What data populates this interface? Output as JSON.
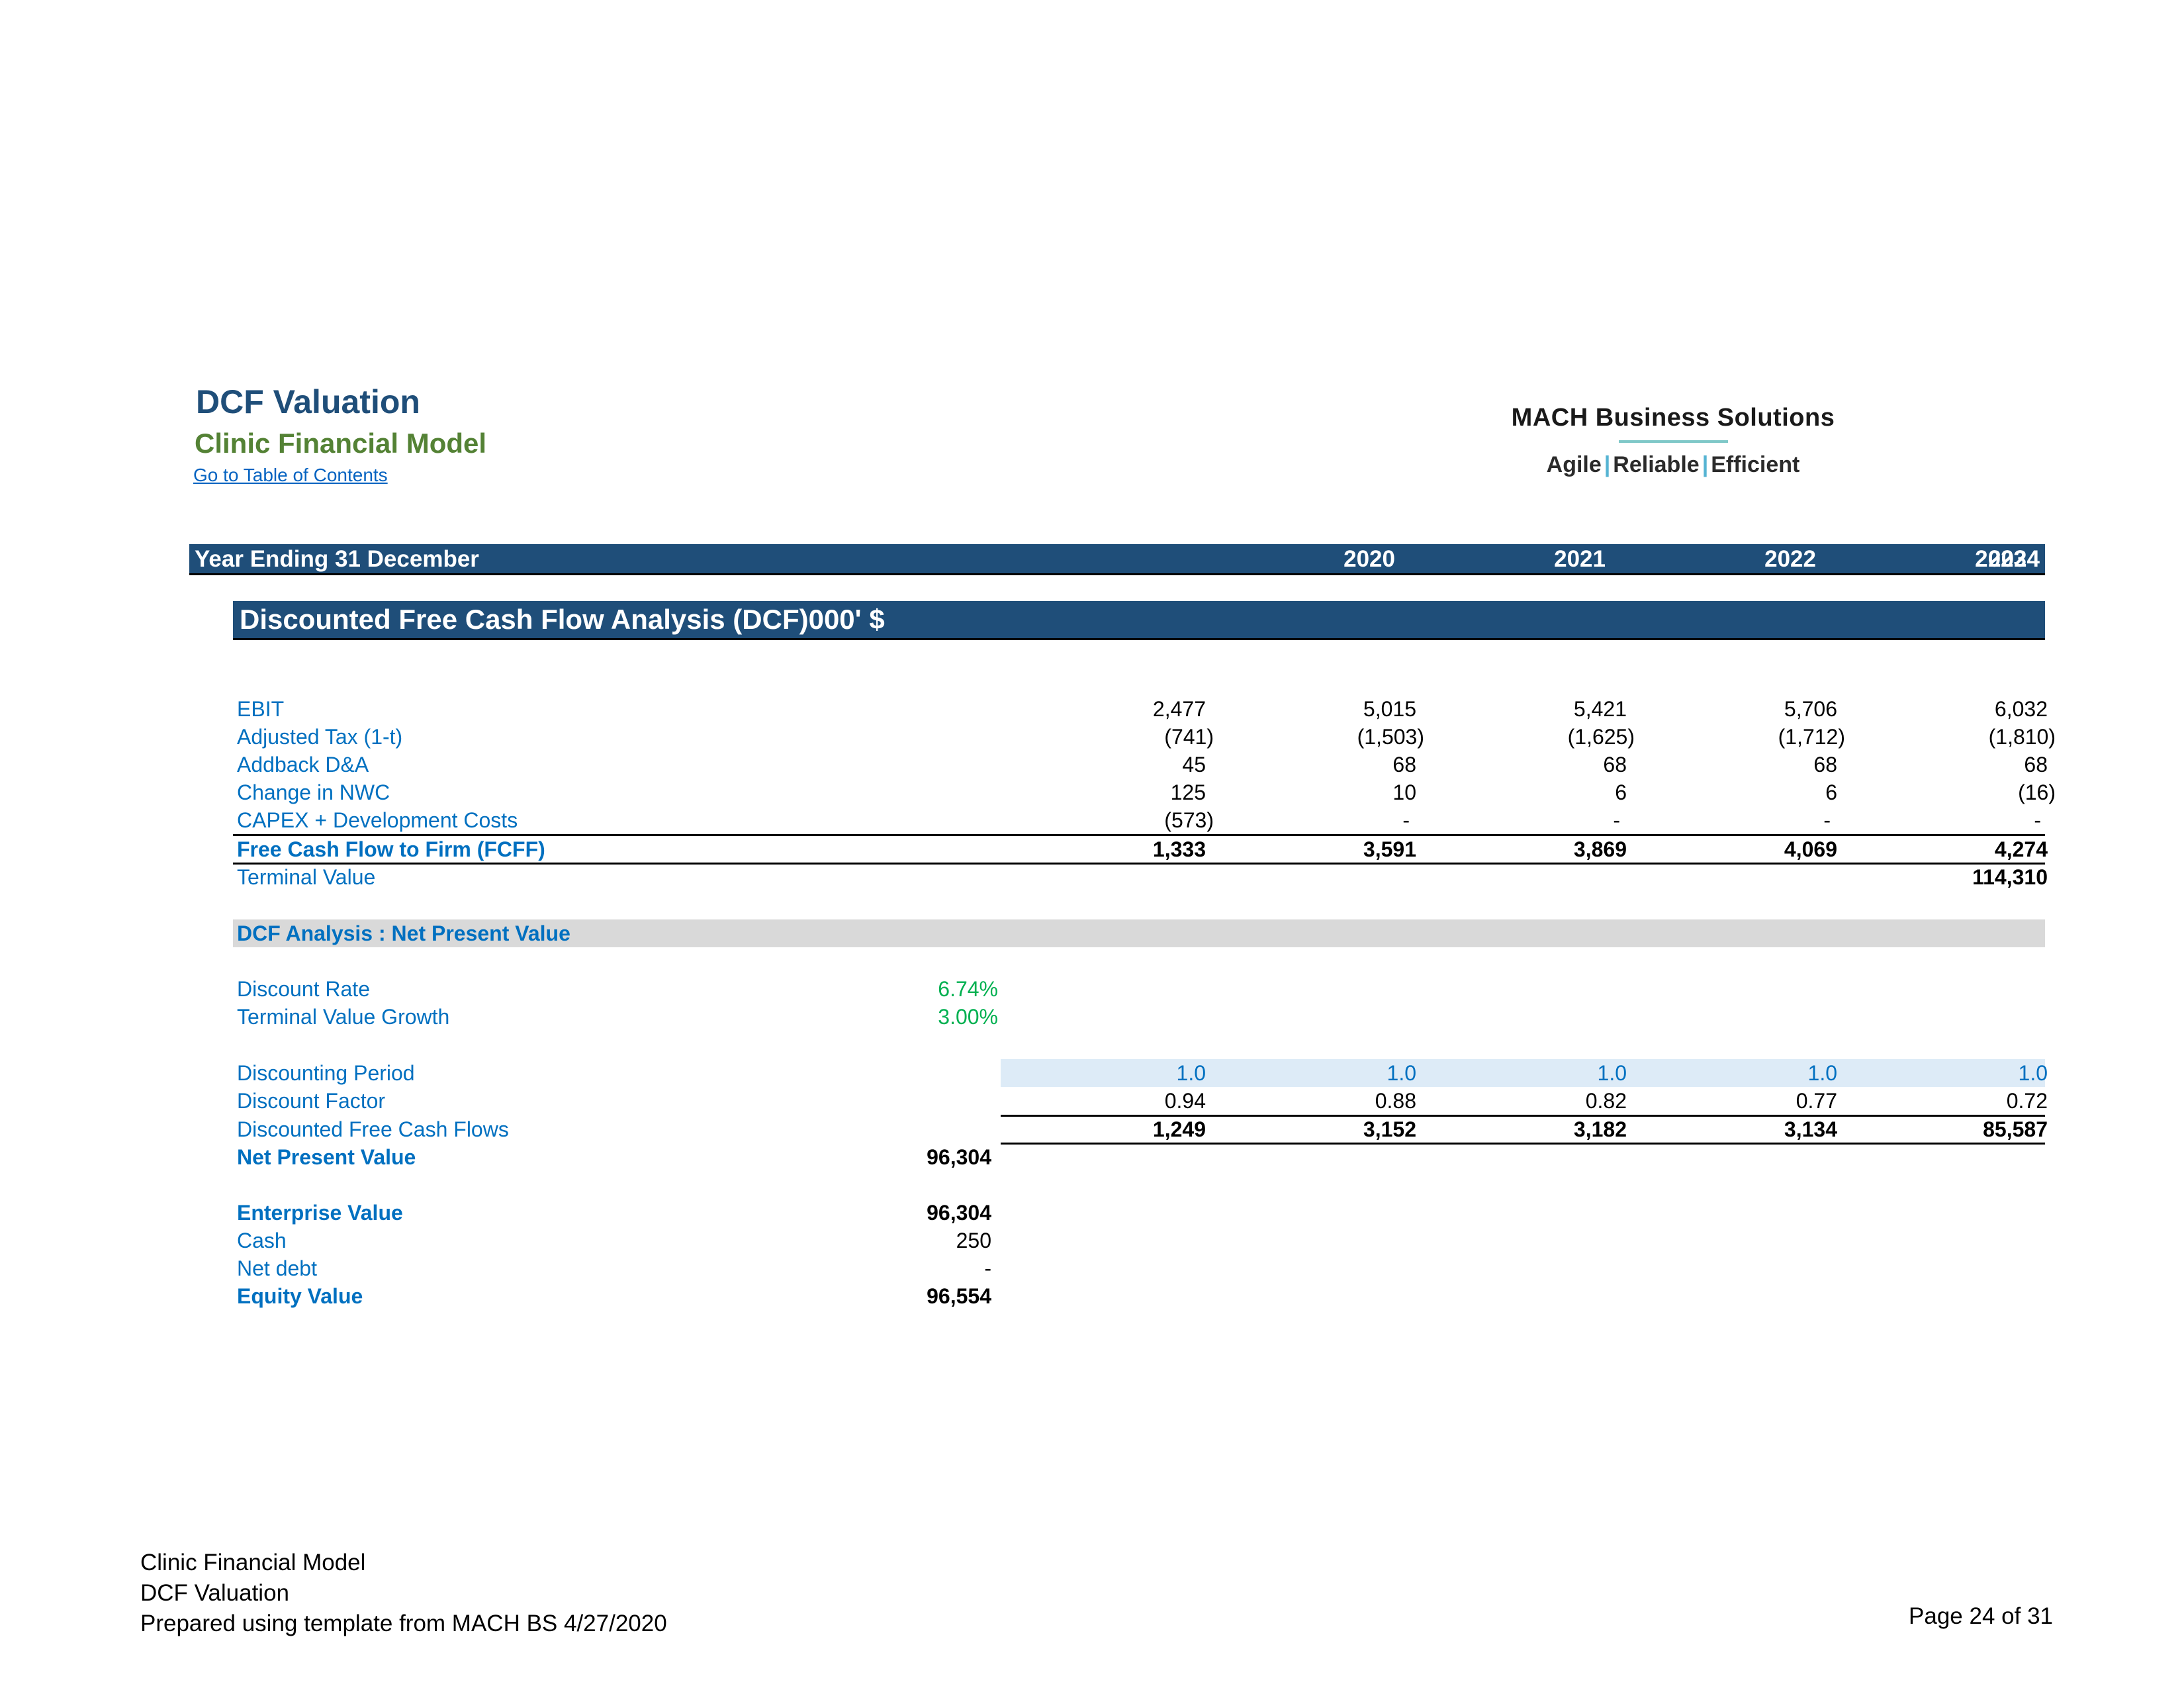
{
  "header": {
    "title": "DCF Valuation",
    "subtitle": "Clinic Financial Model",
    "toc_link": "Go to Table of Contents"
  },
  "logo": {
    "name": "MACH Business Solutions",
    "tag1": "Agile",
    "sep": "|",
    "tag2": "Reliable",
    "tag3": "Efficient"
  },
  "yearbar": {
    "label": "Year Ending 31 December",
    "years": [
      "2020",
      "2021",
      "2022",
      "2023",
      "2024"
    ]
  },
  "section_title": "Discounted Free Cash Flow Analysis (DCF)000' $",
  "cashflow": {
    "ebit": {
      "label": "EBIT",
      "values": [
        "2,477",
        "5,015",
        "5,421",
        "5,706",
        "6,032"
      ]
    },
    "tax": {
      "label": "Adjusted Tax (1-t)",
      "values": [
        "(741)",
        "(1,503)",
        "(1,625)",
        "(1,712)",
        "(1,810)"
      ]
    },
    "da": {
      "label": "Addback D&A",
      "values": [
        "45",
        "68",
        "68",
        "68",
        "68"
      ]
    },
    "nwc": {
      "label": "Change in NWC",
      "values": [
        "125",
        "10",
        "6",
        "6",
        "(16)"
      ]
    },
    "capex": {
      "label": "CAPEX + Development Costs",
      "values": [
        "(573)",
        "-",
        "-",
        "-",
        "-"
      ]
    },
    "fcff": {
      "label": "Free Cash Flow to Firm (FCFF)",
      "values": [
        "1,333",
        "3,591",
        "3,869",
        "4,069",
        "4,274"
      ]
    },
    "terminal": {
      "label": "Terminal Value",
      "value_2024": "114,310"
    }
  },
  "npv_section": {
    "title": "DCF Analysis : Net Present Value",
    "discount_rate": {
      "label": "Discount Rate",
      "value": "6.74%"
    },
    "tv_growth": {
      "label": "Terminal Value Growth",
      "value": "3.00%"
    },
    "period": {
      "label": "Discounting Period",
      "values": [
        "1.0",
        "1.0",
        "1.0",
        "1.0",
        "1.0"
      ]
    },
    "factor": {
      "label": "Discount Factor",
      "values": [
        "0.94",
        "0.88",
        "0.82",
        "0.77",
        "0.72"
      ]
    },
    "dcf": {
      "label": "Discounted Free Cash Flows",
      "values": [
        "1,249",
        "3,152",
        "3,182",
        "3,134",
        "85,587"
      ]
    },
    "npv": {
      "label": "Net Present Value",
      "value": "96,304"
    },
    "ev": {
      "label": "Enterprise Value",
      "value": "96,304"
    },
    "cash": {
      "label": "Cash",
      "value": "250"
    },
    "net_debt": {
      "label": "Net debt",
      "value": "-"
    },
    "equity": {
      "label": "Equity Value",
      "value": "96,554"
    }
  },
  "footer": {
    "line1": "Clinic Financial Model",
    "line2": "DCF Valuation",
    "line3": "Prepared using template from MACH BS 4/27/2020",
    "page": "Page 24 of 31"
  }
}
